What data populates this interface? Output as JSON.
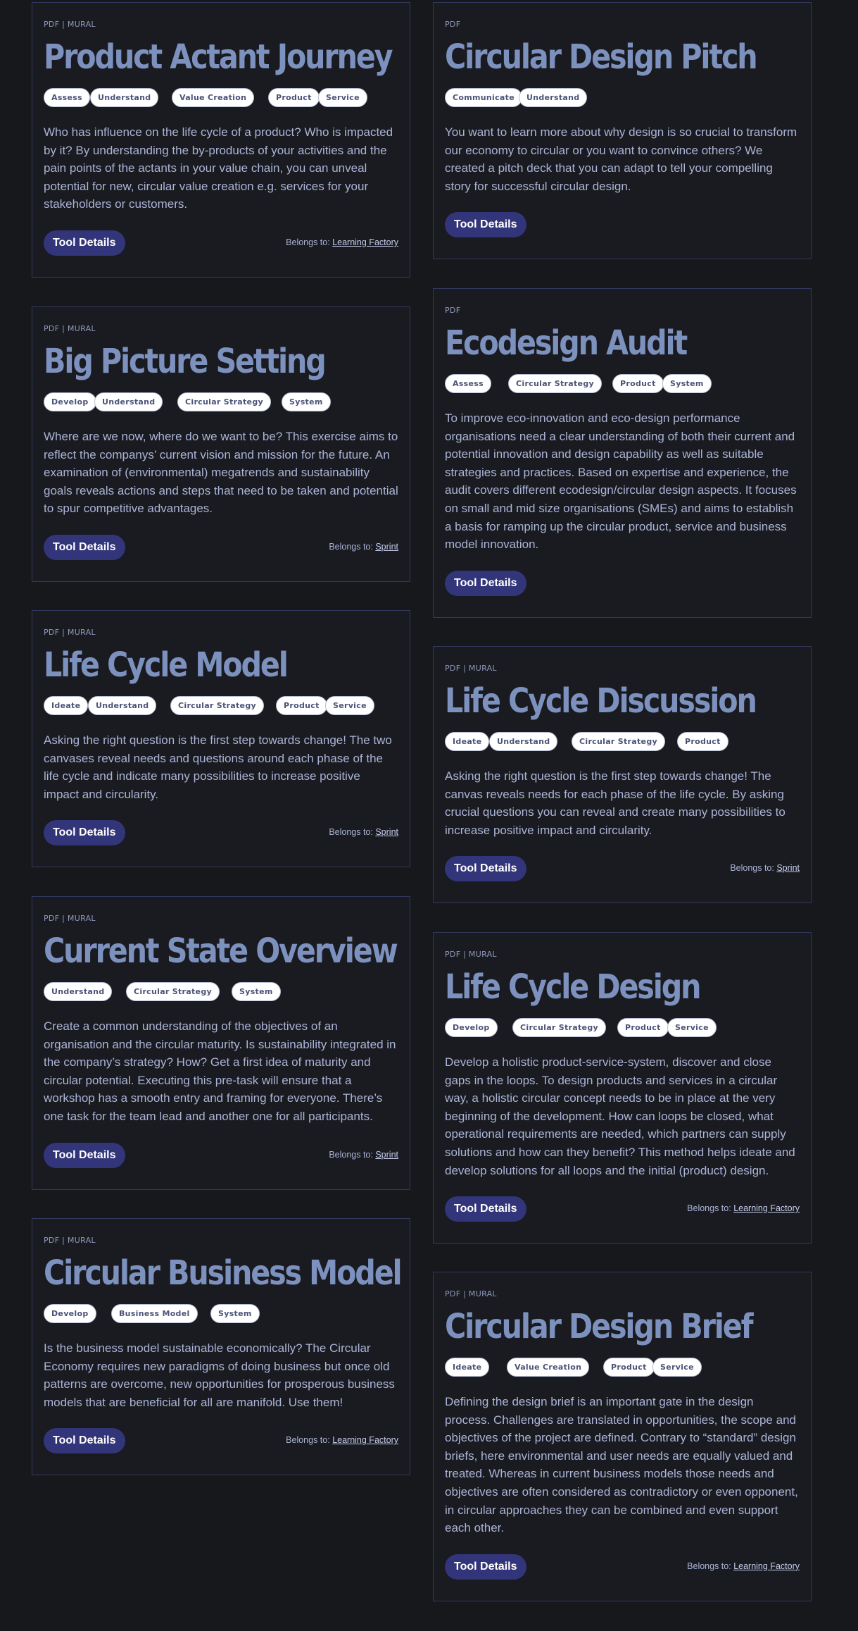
{
  "button_label": "Tool Details",
  "belongs_label": "Belongs to:",
  "cards": [
    {
      "meta": "PDF | MURAL",
      "title": "Product Actant Journey",
      "tags": [
        "Assess",
        "Understand",
        "Value Creation",
        "Product",
        "Service"
      ],
      "description": "Who has influence on the life cycle of a product? Who is impacted by it? By understanding the by-products of your activities and the pain points of the actants in your value chain, you can unveal potential for new, circular value creation e.g. services for your stakeholders or customers.",
      "belongs_to": "Learning Factory"
    },
    {
      "meta": "PDF",
      "title": "Circular Design Pitch",
      "tags": [
        "Communicate",
        "Understand"
      ],
      "description": "You want to learn more about why design is so crucial to transform our economy to circular or you want to convince others? We created a pitch deck that you can adapt to tell your compelling story for successful circular design.",
      "belongs_to": ""
    },
    {
      "meta": "PDF | MURAL",
      "title": "Big Picture Setting",
      "tags": [
        "Develop",
        "Understand",
        "Circular Strategy",
        "System"
      ],
      "description": "Where are we now, where do we want to be? This exercise aims to reflect the companys’ current vision and mission for the future. An examination of (environmental) megatrends and sustainability goals reveals actions and steps that need to be taken and potential to spur competitive advantages.",
      "belongs_to": "Sprint"
    },
    {
      "meta": "PDF",
      "title": "Ecodesign Audit",
      "tags": [
        "Assess",
        "Circular Strategy",
        "Product",
        "System"
      ],
      "description": "To improve eco-innovation and eco-design performance organisations need a clear understanding of both their current and potential innovation and design capability as well as suitable strategies and practices. Based on expertise and experience, the audit covers different ecodesign/circular design aspects. It focuses on small and mid size organisations (SMEs) and aims to establish a basis for ramping up the circular product, service and business model innovation.",
      "belongs_to": ""
    },
    {
      "meta": "PDF | MURAL",
      "title": "Life Cycle Model",
      "tags": [
        "Ideate",
        "Understand",
        "Circular Strategy",
        "Product",
        "Service"
      ],
      "description": "Asking the right question is the first step towards change! The two canvases reveal needs and questions around each phase of the life cycle and indicate many possibilities to increase positive impact and circularity.",
      "belongs_to": "Sprint"
    },
    {
      "meta": "PDF | MURAL",
      "title": "Life Cycle Discussion",
      "tags": [
        "Ideate",
        "Understand",
        "Circular Strategy",
        "Product"
      ],
      "description": "Asking the right question is the first step towards change! The canvas reveals needs for each phase of the life cycle. By asking crucial questions you can reveal and create many possibilities to increase positive impact and circularity.",
      "belongs_to": "Sprint"
    },
    {
      "meta": "PDF | MURAL",
      "title": "Current State Overview",
      "tags": [
        "Understand",
        "Circular Strategy",
        "System"
      ],
      "description": "Create a common understanding of the objectives of an organisation and the circular maturity. Is sustainability integrated in the company’s strategy? How? Get a first idea of maturity and circular potential. Executing this pre-task will ensure that a workshop has a smooth entry and framing for everyone. There’s one task for the team lead and another one for all participants.",
      "belongs_to": "Sprint"
    },
    {
      "meta": "PDF | MURAL",
      "title": "Life Cycle Design",
      "tags": [
        "Develop",
        "Circular Strategy",
        "Product",
        "Service"
      ],
      "description": "Develop a holistic product-service-system, discover and close gaps in the loops. To design products and services in a circular way, a holistic circular concept needs to be in place at the very beginning of the development. How can loops be closed, what operational requirements are needed, which partners can supply solutions and how can they benefit? This method helps ideate and develop solutions for all loops and the initial (product) design.",
      "belongs_to": "Learning Factory"
    },
    {
      "meta": "PDF | MURAL",
      "title": "Circular Business Model",
      "tags": [
        "Develop",
        "Business Model",
        "System"
      ],
      "description": "Is the business model sustainable economically? The Circular Economy requires new paradigms of doing business but once old patterns are overcome, new opportunities for prosperous business models that are beneficial for all are manifold. Use them!",
      "belongs_to": "Learning Factory"
    },
    {
      "meta": "PDF | MURAL",
      "title": "Circular Design Brief",
      "tags": [
        "Ideate",
        "Value Creation",
        "Product",
        "Service"
      ],
      "description": "Defining the design brief is an important gate in the design process. Challenges are translated in opportunities, the scope and objectives of the project are defined. Contrary to “standard” design briefs, here environmental and user needs are equally valued and treated. Whereas in current business models those needs and objectives are often considered as contradictory or even opponent, in circular approaches they can be combined and even support each other.",
      "belongs_to": "Learning Factory"
    }
  ]
}
